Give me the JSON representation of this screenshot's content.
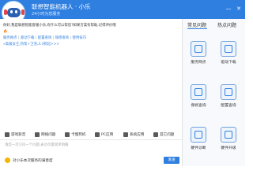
{
  "header": {
    "title": "联想智能机器人 · 小乐",
    "subtitle": "24小时为您服务",
    "minimize_glyph": "—",
    "close_glyph": "✕",
    "color": "#2f7fe0"
  },
  "chat": {
    "greeting_line1": "你好,我是联想智能客服小乐,有什么可以帮您?如果方案有帮助,记得评价哦",
    "greeting_line2": "🔥",
    "links": [
      "服务网点",
      "驱动下载",
      "配置查询",
      "保修查询",
      "使用技巧"
    ],
    "separator": "|",
    "promo": "»高级女王,热泵+卫浴,3.3折起>>>"
  },
  "toolbar": {
    "items": [
      {
        "label": "游戏影音",
        "icon": "gamepad-icon",
        "color": "#555555"
      },
      {
        "label": "网络问题",
        "icon": "network-icon",
        "color": "#555555"
      },
      {
        "label": "卡慢死机",
        "icon": "slow-icon",
        "color": "#555555"
      },
      {
        "label": "PC应用",
        "icon": "apps-icon",
        "color": "#555555"
      },
      {
        "label": "系统应用",
        "icon": "system-icon",
        "color": "#555555"
      },
      {
        "label": "其它问题",
        "icon": "other-icon",
        "color": "#555555"
      }
    ]
  },
  "input": {
    "placeholder": "请您一次只问一个问题,表达尽量简单明确"
  },
  "footer": {
    "survey_label": "对小乐本次服务的满意度",
    "send_label": "发送"
  },
  "sidebar": {
    "tab_common": "常见问题",
    "tab_hot": "热点问题",
    "items": [
      {
        "label": "服务网点",
        "icon": "location-icon"
      },
      {
        "label": "驱动下载",
        "icon": "download-icon"
      },
      {
        "label": "保修查询",
        "icon": "warranty-icon"
      },
      {
        "label": "配置查询",
        "icon": "config-icon"
      },
      {
        "label": "硬件诊断",
        "icon": "diagnosis-icon"
      },
      {
        "label": "硬件升级",
        "icon": "upgrade-icon"
      }
    ]
  }
}
